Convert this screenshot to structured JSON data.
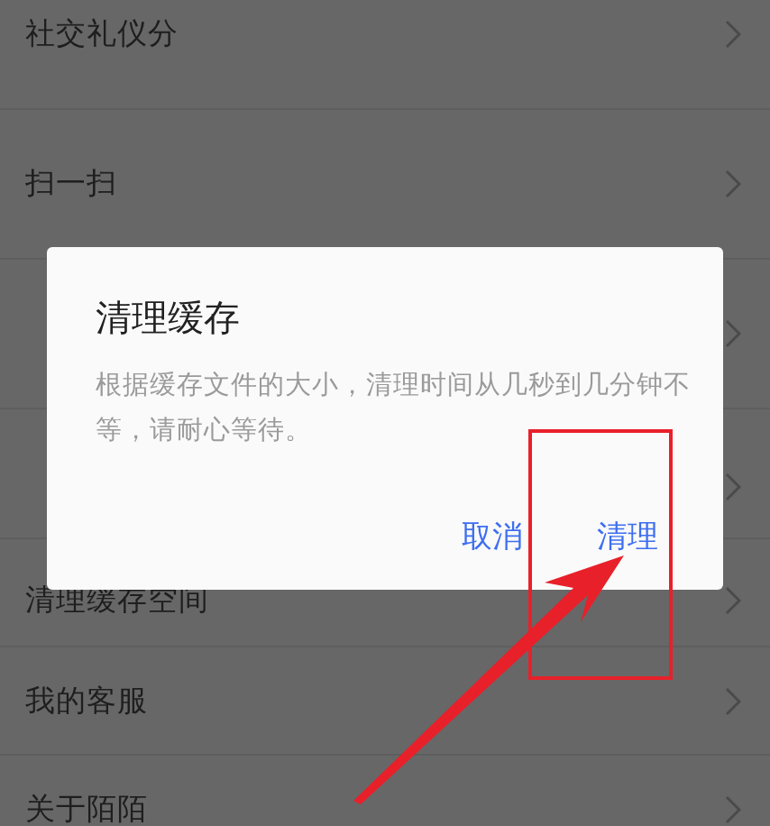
{
  "settings_list": [
    {
      "kind": "item",
      "label": "社交礼仪分"
    },
    {
      "kind": "item",
      "label": "扫一扫"
    },
    {
      "kind": "covered"
    },
    {
      "kind": "covered"
    },
    {
      "kind": "item",
      "label": "清理缓存空间"
    },
    {
      "kind": "item",
      "label": "我的客服"
    },
    {
      "kind": "item",
      "label": "关于陌陌"
    }
  ],
  "dialog": {
    "title": "清理缓存",
    "message": "根据缓存文件的大小，清理时间从几秒到几分钟不等，请耐心等待。",
    "buttons": [
      {
        "label": "取消"
      },
      {
        "label": "清理"
      }
    ]
  }
}
